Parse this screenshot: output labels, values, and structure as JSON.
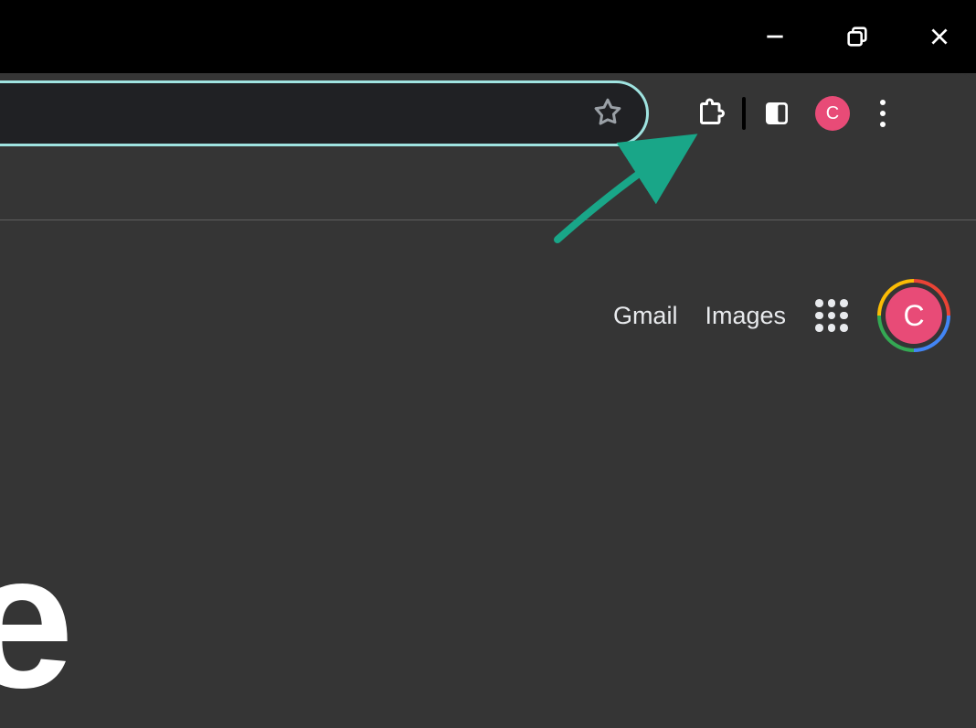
{
  "window": {
    "controls": {
      "minimize": "minimize",
      "maximize": "maximize",
      "close": "close"
    }
  },
  "toolbar": {
    "star_label": "Bookmark this tab",
    "extensions_label": "Extensions",
    "sidepanel_label": "Side panel",
    "profile_initial": "C",
    "menu_label": "Customize and control"
  },
  "content_header": {
    "gmail": "Gmail",
    "images": "Images",
    "apps_label": "Google apps",
    "account_initial": "C"
  },
  "glyph": "e",
  "annotation": {
    "target": "extensions-icon"
  }
}
